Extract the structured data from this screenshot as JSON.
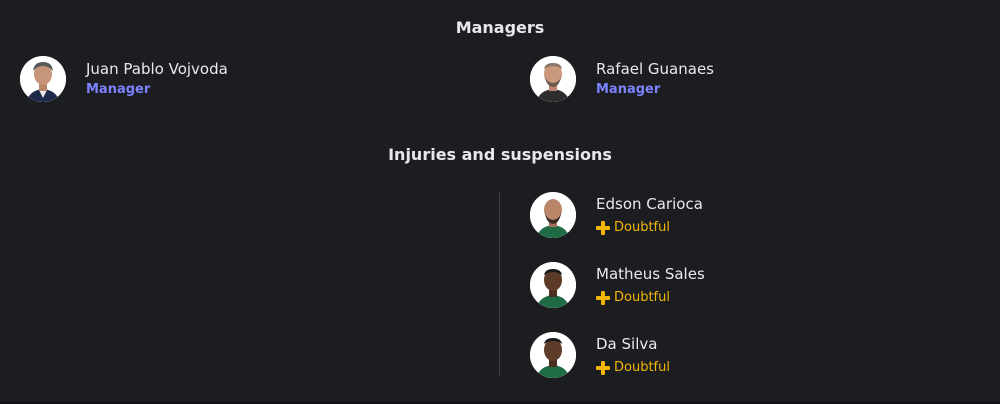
{
  "managers": {
    "title": "Managers",
    "home": {
      "name": "Juan Pablo Vojvoda",
      "role": "Manager"
    },
    "away": {
      "name": "Rafael Guanaes",
      "role": "Manager"
    }
  },
  "injuries": {
    "title": "Injuries and suspensions",
    "players": [
      {
        "name": "Edson Carioca",
        "status": "Doubtful"
      },
      {
        "name": "Matheus Sales",
        "status": "Doubtful"
      },
      {
        "name": "Da Silva",
        "status": "Doubtful"
      }
    ]
  },
  "colors": {
    "background": "#1b1d21",
    "role_accent": "#7c83ff",
    "doubtful": "#f2b705"
  }
}
